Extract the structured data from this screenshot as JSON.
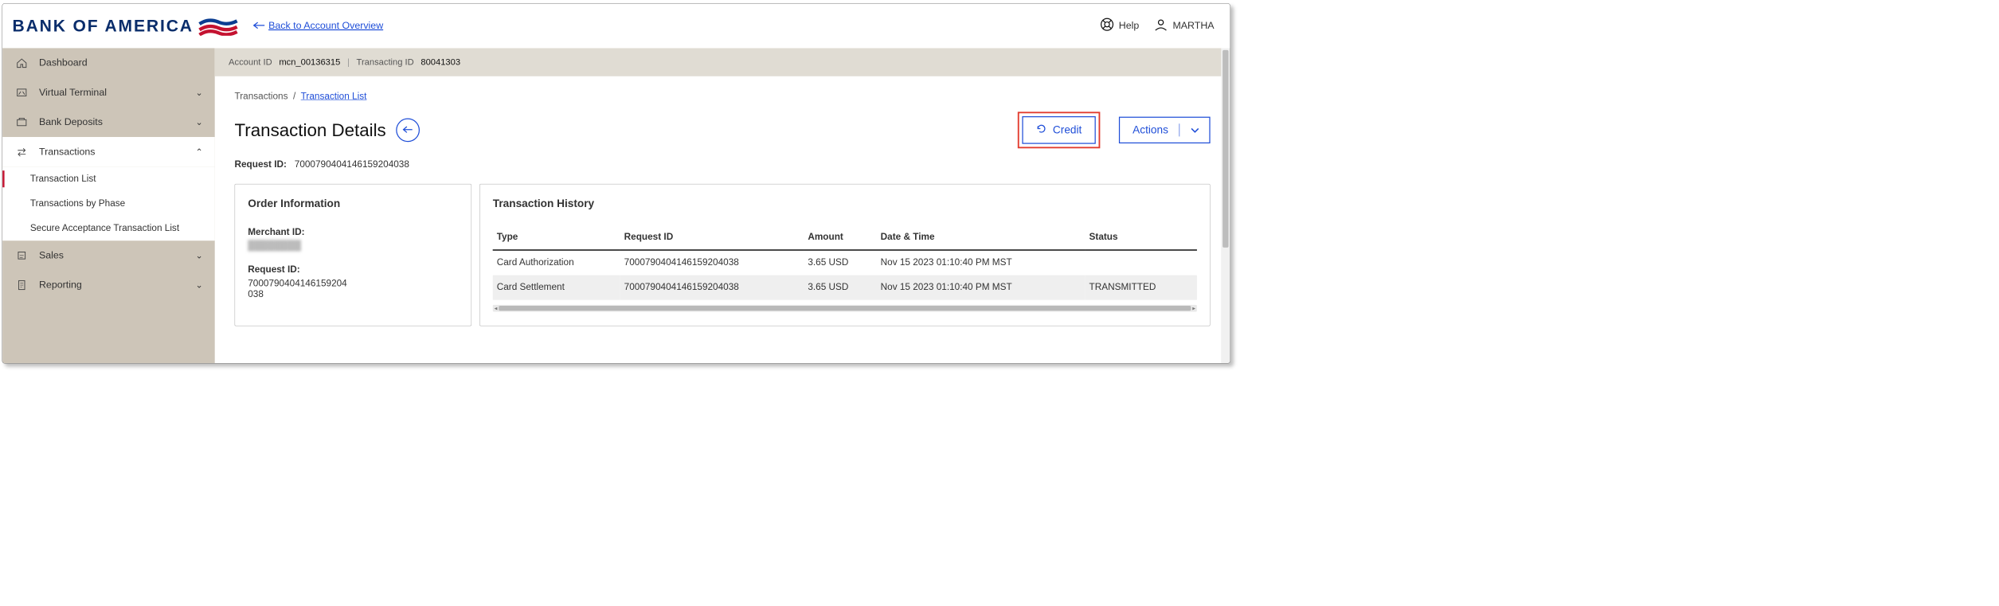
{
  "brand": {
    "name": "BANK OF AMERICA"
  },
  "header": {
    "back_link": "Back to Account Overview",
    "help_label": "Help",
    "user_name": "MARTHA"
  },
  "account_bar": {
    "account_id_label": "Account ID",
    "account_id": "mcn_00136315",
    "transacting_id_label": "Transacting ID",
    "transacting_id": "80041303"
  },
  "sidebar": {
    "items": [
      {
        "label": "Dashboard"
      },
      {
        "label": "Virtual Terminal"
      },
      {
        "label": "Bank Deposits"
      },
      {
        "label": "Transactions"
      },
      {
        "label": "Sales"
      },
      {
        "label": "Reporting"
      }
    ],
    "sub_transactions": [
      "Transaction List",
      "Transactions by Phase",
      "Secure Acceptance Transaction List"
    ]
  },
  "breadcrumb": {
    "root": "Transactions",
    "current": "Transaction List"
  },
  "page": {
    "title": "Transaction Details",
    "request_id_label": "Request ID:",
    "request_id": "7000790404146159204038",
    "credit_button": "Credit",
    "actions_button": "Actions"
  },
  "order_info": {
    "title": "Order Information",
    "merchant_id_label": "Merchant ID:",
    "merchant_id_masked": "████████",
    "request_id_label": "Request ID:",
    "request_id_1": "7000790404146159204",
    "request_id_2": "038"
  },
  "history": {
    "title": "Transaction History",
    "columns": {
      "type": "Type",
      "request_id": "Request ID",
      "amount": "Amount",
      "date_time": "Date & Time",
      "status": "Status"
    },
    "rows": [
      {
        "type": "Card Authorization",
        "request_id": "7000790404146159204038",
        "amount": "3.65 USD",
        "date_time": "Nov 15 2023 01:10:40 PM MST",
        "status": ""
      },
      {
        "type": "Card Settlement",
        "request_id": "7000790404146159204038",
        "amount": "3.65 USD",
        "date_time": "Nov 15 2023 01:10:40 PM MST",
        "status": "TRANSMITTED"
      }
    ]
  }
}
